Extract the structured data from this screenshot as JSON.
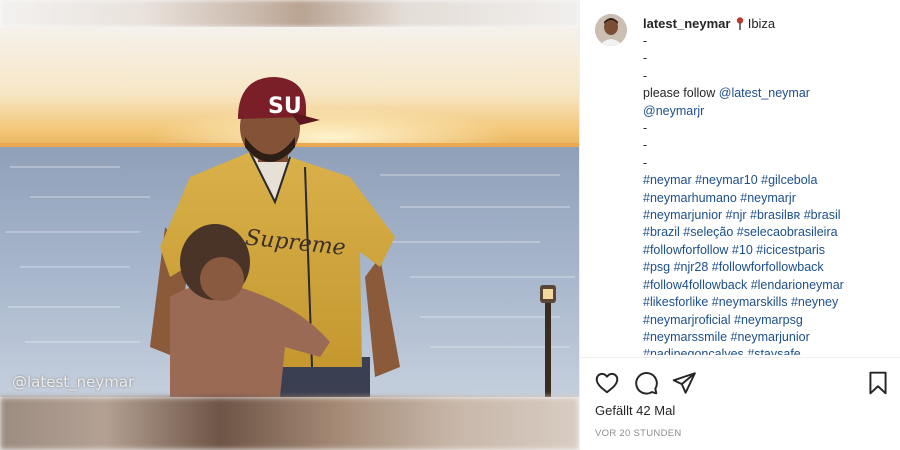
{
  "post": {
    "watermark": "@latest_neymar",
    "cap_logo_text": "SU",
    "jersey_text": "Supreme"
  },
  "header": {
    "username": "latest_neymar",
    "location": "Ibiza"
  },
  "caption": {
    "dash_lines_1": [
      "-",
      "-",
      "-"
    ],
    "follow_text": "please follow ",
    "follow_mention": "@latest_neymar",
    "mention_2": "@neymarjr",
    "dash_lines_2": [
      "-",
      "-",
      "-"
    ],
    "hashtag_lines": [
      "#neymar #neymar10 #gilcebola",
      "#neymarhumano #neymarjr",
      "#neymarjunior #njr #brasilʙʀ #brasil",
      "#brazil #seleção #selecaobrasileira",
      "#followforfollow #10 #icicestparis",
      "#psg #njr28 #followforfollowback",
      "#follow4followback #lendarioneymar",
      "#likesforlike #neymarskills #neyney",
      "#neymarjroficial #neymarpsg",
      "#neymarssmile #neymarjunior",
      "#nadinegoncalves #staysafe"
    ]
  },
  "actions": {
    "like_icon": "heart-icon",
    "comment_icon": "comment-icon",
    "share_icon": "send-icon",
    "save_icon": "bookmark-icon"
  },
  "likes_text": "Gefällt 42 Mal",
  "timestamp": "VOR 20 STUNDEN",
  "colors": {
    "link": "#1d4f8a",
    "text": "#262626",
    "muted": "#8e8e8e",
    "location_pin": "#c0392b"
  }
}
